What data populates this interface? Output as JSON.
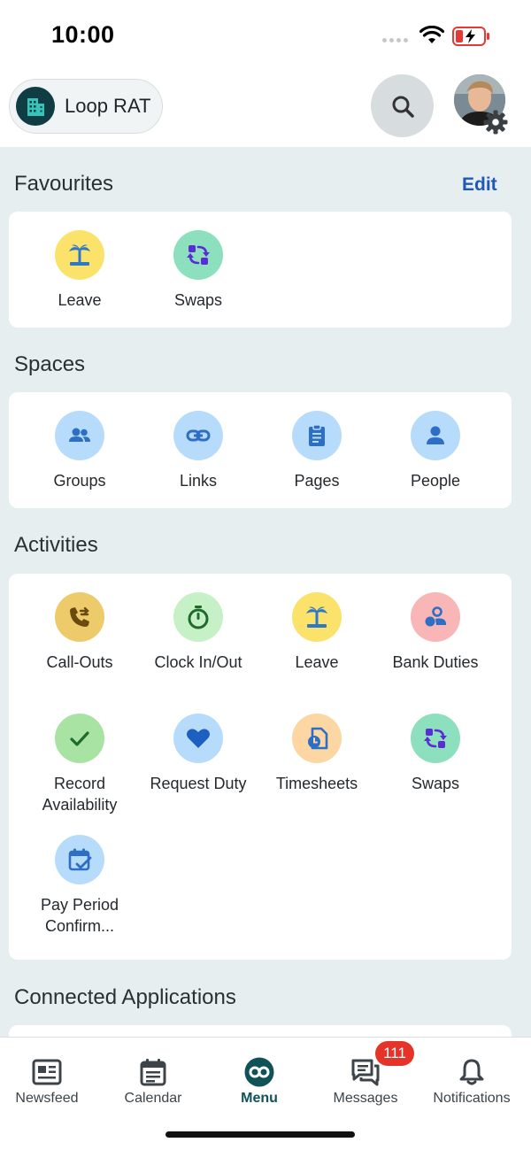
{
  "status_bar": {
    "time": "10:00"
  },
  "header": {
    "workspace_name": "Loop RAT",
    "icons": [
      "building-icon",
      "search-icon",
      "avatar",
      "gear-icon"
    ]
  },
  "favourites": {
    "title": "Favourites",
    "edit_label": "Edit",
    "items": [
      {
        "label": "Leave",
        "icon": "palm-tree-icon",
        "color": "#fbe36b"
      },
      {
        "label": "Swaps",
        "icon": "swap-icon",
        "color": "#8de0be"
      }
    ]
  },
  "spaces": {
    "title": "Spaces",
    "items": [
      {
        "label": "Groups",
        "icon": "groups-icon",
        "color": "#b7dcfb"
      },
      {
        "label": "Links",
        "icon": "link-icon",
        "color": "#b7dcfb"
      },
      {
        "label": "Pages",
        "icon": "pages-icon",
        "color": "#b7dcfb"
      },
      {
        "label": "People",
        "icon": "person-icon",
        "color": "#b7dcfb"
      }
    ]
  },
  "activities": {
    "title": "Activities",
    "items": [
      {
        "label": "Call-Outs",
        "icon": "phone-forward-icon",
        "color": "#edcb6b"
      },
      {
        "label": "Clock In/Out",
        "icon": "stopwatch-icon",
        "color": "#c6f1c7"
      },
      {
        "label": "Leave",
        "icon": "palm-tree-icon",
        "color": "#fbe36b"
      },
      {
        "label": "Bank Duties",
        "icon": "bank-duties-icon",
        "color": "#f8b6b6"
      },
      {
        "label_line1": "Record",
        "label_line2": "Availability",
        "icon": "checkmark-icon",
        "color": "#a8e3a3"
      },
      {
        "label": "Request Duty",
        "icon": "heart-icon",
        "color": "#b7dcfb"
      },
      {
        "label": "Timesheets",
        "icon": "timesheet-icon",
        "color": "#fcd6a3"
      },
      {
        "label": "Swaps",
        "icon": "swap-icon",
        "color": "#8de0be"
      },
      {
        "label_line1": "Pay Period",
        "label_line2": "Confirm...",
        "icon": "calendar-check-icon",
        "color": "#b7dcfb"
      }
    ]
  },
  "connected_applications": {
    "title": "Connected Applications"
  },
  "bottom_nav": {
    "items": [
      {
        "label": "Newsfeed",
        "icon": "newsfeed-icon"
      },
      {
        "label": "Calendar",
        "icon": "calendar-icon"
      },
      {
        "label": "Menu",
        "icon": "menu-loop-icon",
        "active": true
      },
      {
        "label": "Messages",
        "icon": "messages-icon",
        "badge": "111"
      },
      {
        "label": "Notifications",
        "icon": "bell-icon"
      }
    ]
  },
  "colors": {
    "accent_blue": "#1e58b8",
    "brand_teal": "#0f5258",
    "page_background": "#e7eeef",
    "badge_red": "#e5332a"
  }
}
